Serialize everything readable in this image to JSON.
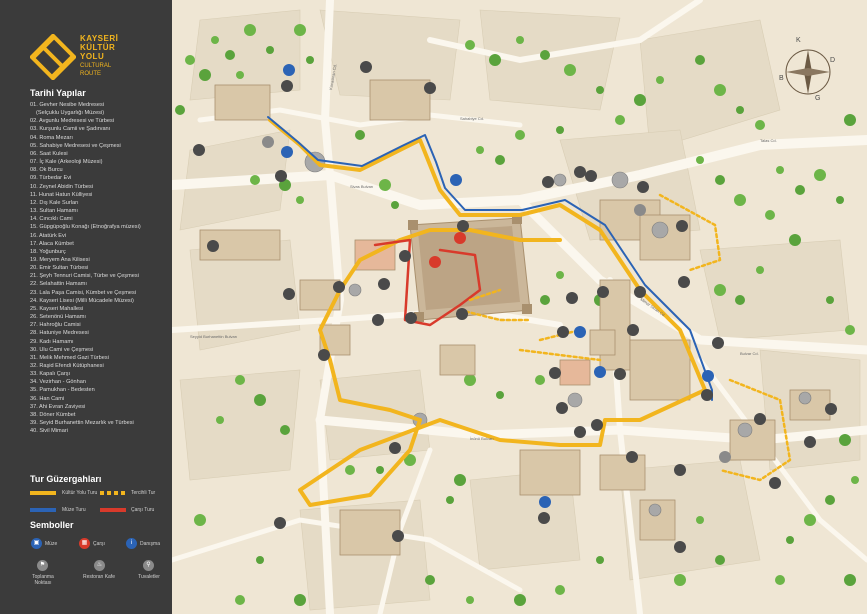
{
  "brand": {
    "name_lines": [
      "KAYSERİ",
      "KÜLTÜR",
      "YOLU"
    ],
    "sub_lines": [
      "CULTURAL",
      "ROUTE"
    ],
    "accent": "#f2b51e"
  },
  "historic": {
    "title": "Tarihi Yapılar",
    "items": [
      "01. Gevher Nesibe Medresesi",
      "(Selçuklu Uygarlığı Müzesi)",
      "02. Avgunlu Medresesi ve Türbesi",
      "03. Kurşunlu Camii ve Şadırvanı",
      "04. Roma Mezarı",
      "05. Sahabiye Medresesi ve Çeşmesi",
      "06. Saat Kulesi",
      "07. İç Kale (Arkeoloji Müzesi)",
      "08. Ok Burcu",
      "09. Türbedar Evi",
      "10. Zeynel Abidin Türbesi",
      "11. Hunat Hatun Külliyesi",
      "12. Dış Kale Surları",
      "13. Sultan Hamamı",
      "14. Cıncıklı Cami",
      "15. Güpgüpoğlu Konağı (Etnoğrafya müzesi)",
      "16. Atatürk Evi",
      "17. Alaca Kümbet",
      "18. Yoğunburç",
      "19. Meryem Ana Kilisesi",
      "20. Emir Sultan Türbesi",
      "21. Şeyh Tennuri Camisi, Türbe ve Çeşmesi",
      "22. Selahattin Hamamı",
      "23. Lala Paşa Camisi, Kümbet ve Çeşmesi",
      "24. Kayseri Lisesi (Milli Mücadele Müzesi)",
      "25. Kayseri Mahallesi",
      "26. Setenönü Hamamı",
      "27. Hahroğlu Camisi",
      "28. Hatuniye Medresesi",
      "29. Kadı Hamamı",
      "30. Ulu Cami ve Çeşmesi",
      "31. Melik Mehmed Gazi Türbesi",
      "32. Raşid Efendi Kütüphanesi",
      "33. Kapalı Çarşı",
      "34. Vezirhan - Gönhan",
      "35. Pamukhan - Bedesten",
      "36. Han Cami",
      "37. Ahi Evran Zaviyesi",
      "38. Döner Kümbet",
      "39. Seyid Burhanettin Mezarlık ve Türbesi",
      "40. Sivil Mimari"
    ]
  },
  "routes": {
    "title": "Tur Güzergahları",
    "items": [
      {
        "label": "Kültür Yolu Turu",
        "color": "#f2b51e",
        "style": "solid"
      },
      {
        "label": "Tercihli Tur",
        "color": "#f2b51e",
        "style": "dashed"
      },
      {
        "label": "Müze Turu",
        "color": "#2b63b5",
        "style": "solid"
      },
      {
        "label": "Çarşı Turu",
        "color": "#d83a2b",
        "style": "solid"
      }
    ]
  },
  "symbols": {
    "title": "Semboller",
    "items": [
      {
        "label": "Müze",
        "icon": "museum-icon",
        "color": "#2b63b5"
      },
      {
        "label": "Çarşı",
        "icon": "bazaar-icon",
        "color": "#d83a2b"
      },
      {
        "label": "Danışma",
        "icon": "info-icon",
        "color": "#2b63b5"
      },
      {
        "label": "Toplanma Noktası",
        "icon": "meeting-point-icon",
        "color": "#8a8a8a"
      },
      {
        "label": "Restoran Kafe",
        "icon": "restaurant-icon",
        "color": "#8a8a8a"
      },
      {
        "label": "Tuvaletler",
        "icon": "toilet-icon",
        "color": "#8a8a8a"
      }
    ]
  },
  "compass": {
    "labels": [
      "K",
      "D",
      "G",
      "B"
    ]
  },
  "map": {
    "colors": {
      "ground": "#efe6d4",
      "road": "#fbf7ee",
      "tree": "#5aa33c",
      "marker": "#4a4a4a"
    },
    "street_labels": [
      "Sivas Bulvarı",
      "Talas Cd.",
      "Kocasinan Cd.",
      "Sahabiye Cd.",
      "İnönü Bulvarı",
      "Mimar Sinan Cd.",
      "Bulvar Cd.",
      "Seyyid Burhanettin Bulvarı"
    ]
  }
}
